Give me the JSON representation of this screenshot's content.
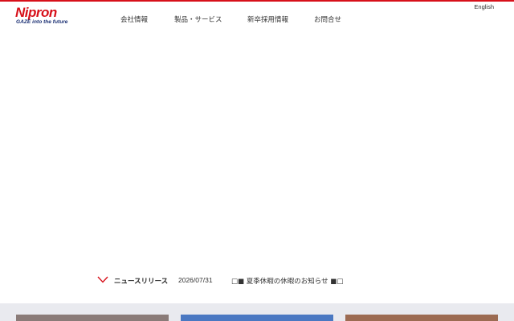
{
  "brand": {
    "logo_text": "Nipron",
    "tagline": "GAZE into the future",
    "accent_color": "#d7101a",
    "tagline_color": "#1a2f73"
  },
  "header": {
    "nav": [
      {
        "label": "会社情報"
      },
      {
        "label": "製品・サービス"
      },
      {
        "label": "新卒採用情報"
      },
      {
        "label": "お問合せ"
      }
    ],
    "language_link": "English"
  },
  "news": {
    "section_label": "ニュースリリース",
    "chevron_icon": "chevron-down-icon",
    "date": "2026/07/31",
    "headline": "□■ 夏季休暇の休暇のお知らせ ■□"
  },
  "cards": [
    {
      "color": "#8a7b78"
    },
    {
      "color": "#4a78c2"
    },
    {
      "color": "#9c6b52"
    }
  ]
}
